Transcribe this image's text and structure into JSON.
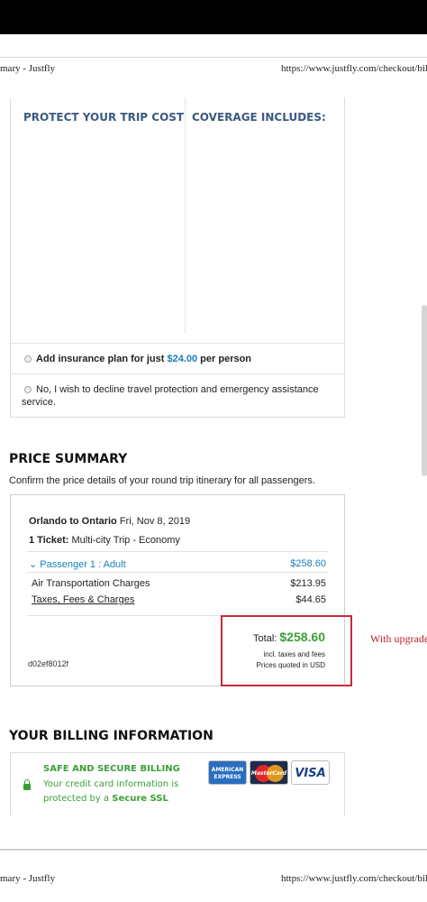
{
  "print_header": {
    "title": "mary - Justfly",
    "url": "https://www.justfly.com/checkout/bil"
  },
  "insurance": {
    "protect_heading": "PROTECT YOUR TRIP COST",
    "coverage_heading": "COVERAGE INCLUDES:",
    "add_prefix": "Add insurance plan for just ",
    "add_price": "$24.00",
    "add_suffix": " per person",
    "decline_text": "No, I wish to decline travel protection and emergency assistance service."
  },
  "price_summary": {
    "title": "PRICE SUMMARY",
    "subtitle": "Confirm the price details of your round trip itinerary for all passengers.",
    "route": "Orlando to Ontario",
    "date": " Fri, Nov 8, 2019",
    "ticket_label": "1 Ticket:",
    "ticket_desc": " Multi-city Trip - Economy",
    "passenger_label": "Passenger 1 : Adult",
    "passenger_amount": "$258.60",
    "lines": [
      {
        "label": "Air Transportation Charges",
        "amount": "$213.95"
      },
      {
        "label": "Taxes, Fees & Charges",
        "amount": "$44.65"
      }
    ],
    "reference": "d02ef8012f",
    "total_label": "Total: ",
    "total_amount": "$258.60",
    "incl_note": "incl. taxes and fees",
    "currency_note": "Prices quoted in USD"
  },
  "annotation": {
    "upgrade_note": "With upgrade"
  },
  "billing": {
    "title": "YOUR BILLING INFORMATION",
    "secure_heading": "SAFE AND SECURE BILLING",
    "secure_text": "Your credit card information is protected by a ",
    "secure_ssl": "Secure SSL",
    "cards": [
      "AMERICAN",
      "EXPRESS",
      "MasterCard",
      "VISA"
    ]
  },
  "colors": {
    "link_blue": "#1a7fb8",
    "heading_blue": "#3b5a80",
    "price_green": "#3aa035",
    "annotation_red": "#c62b38"
  }
}
